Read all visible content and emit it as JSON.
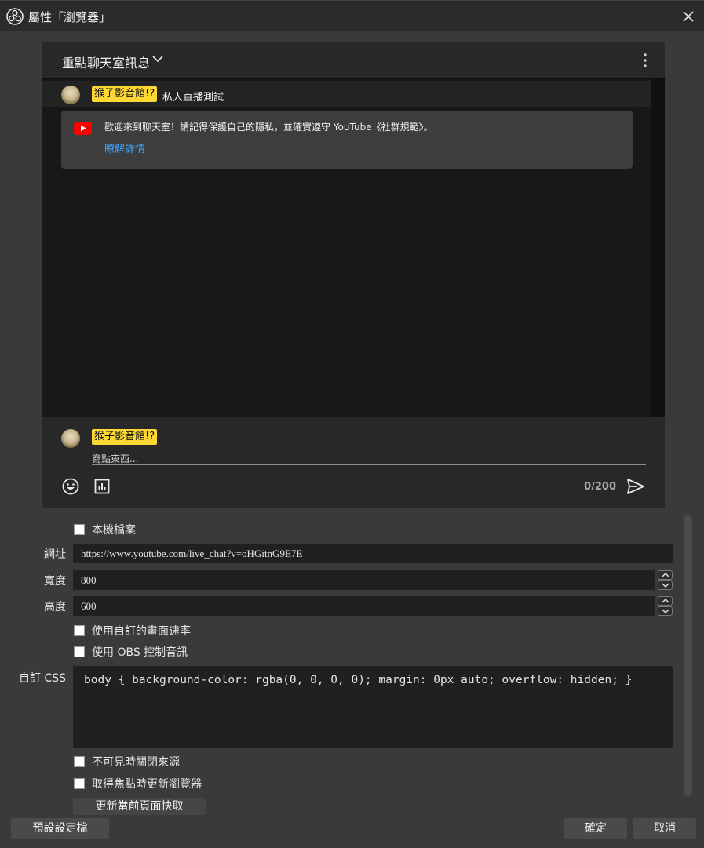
{
  "window": {
    "title": "屬性「瀏覽器」"
  },
  "chat": {
    "header_title": "重點聊天室訊息",
    "pinned": {
      "badge": "猴子影音館!?",
      "text": "私人直播測試"
    },
    "welcome": {
      "text": "歡迎來到聊天室！請記得保護自己的隱私，並確實遵守 YouTube《社群規範》。",
      "link": "瞭解詳情"
    },
    "composer": {
      "badge": "猴子影音館!?",
      "placeholder": "寫點東西...",
      "char_count": "0/200"
    }
  },
  "form": {
    "local_file_label": "本機檔案",
    "url_label": "網址",
    "url_value": "https://www.youtube.com/live_chat?v=oHGitnG9E7E",
    "width_label": "寬度",
    "width_value": "800",
    "height_label": "高度",
    "height_value": "600",
    "custom_fps_label": "使用自訂的畫面速率",
    "obs_audio_label": "使用 OBS 控制音訊",
    "css_label": "自訂 CSS",
    "css_value": "body { background-color: rgba(0, 0, 0, 0); margin: 0px auto; overflow: hidden; }",
    "shutdown_hidden_label": "不可見時關閉來源",
    "refresh_on_active_label": "取得焦點時更新瀏覽器",
    "refresh_cache_button": "更新當前頁面快取"
  },
  "buttons": {
    "defaults": "預設設定檔",
    "ok": "確定",
    "cancel": "取消"
  },
  "icons": {
    "app": "obs-logo-icon",
    "close": "close-icon",
    "chevron": "chevron-down-icon",
    "menu": "more-vert-icon",
    "youtube": "youtube-icon",
    "emoji": "emoji-icon",
    "stats": "bar-chart-icon",
    "send": "send-icon",
    "spin_up": "chevron-up-icon",
    "spin_down": "chevron-down-icon"
  },
  "colors": {
    "accent_badge": "#fdd835",
    "link": "#3ea6ff",
    "youtube_red": "#ff0000"
  }
}
